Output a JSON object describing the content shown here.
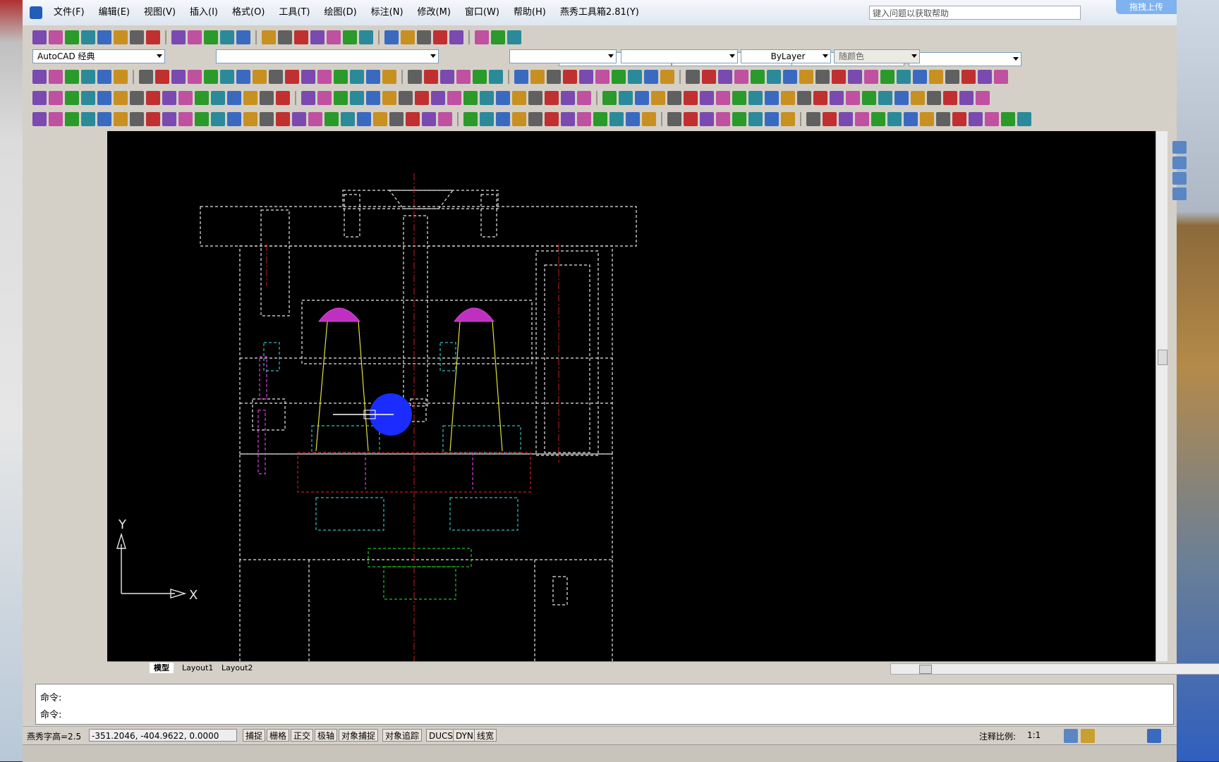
{
  "title_bar": {
    "menus": [
      "文件(F)",
      "编辑(E)",
      "视图(V)",
      "插入(I)",
      "格式(O)",
      "工具(T)",
      "绘图(D)",
      "标注(N)",
      "修改(M)",
      "窗口(W)",
      "帮助(H)",
      "燕秀工具箱2.81(Y)"
    ],
    "help_placeholder": "键入问题以获取帮助",
    "upload_badge": "拖拽上传"
  },
  "toolbars": {
    "workspace": "AutoCAD 经典",
    "linetype": "ByLayer",
    "color": "随颜色"
  },
  "tabs": [
    "模型",
    "Layout1",
    "Layout2"
  ],
  "ucs": {
    "y_label": "Y",
    "x_label": "X"
  },
  "command": {
    "line1": "命令:",
    "line2": "命令:"
  },
  "status": {
    "text_height": "燕秀字高=2.5",
    "coordinates": "-351.2046,  -404.9622,  0.0000",
    "toggles": [
      "捕捉",
      "栅格",
      "正交",
      "极轴",
      "对象捕捉",
      "对象追踪",
      "DUCS",
      "DYN",
      "线宽"
    ],
    "annotation_scale_label": "注释比例:",
    "annotation_scale": "1:1"
  },
  "colors": {
    "canvas": "#000000",
    "drawing_white": "#e6e6e6",
    "drawing_magenta": "#e040e0",
    "drawing_cyan": "#30c0c0",
    "drawing_red": "#c02020",
    "drawing_green": "#20c020",
    "drawing_yellow": "#e0e040",
    "cursor_blue": "#1a2cff"
  }
}
